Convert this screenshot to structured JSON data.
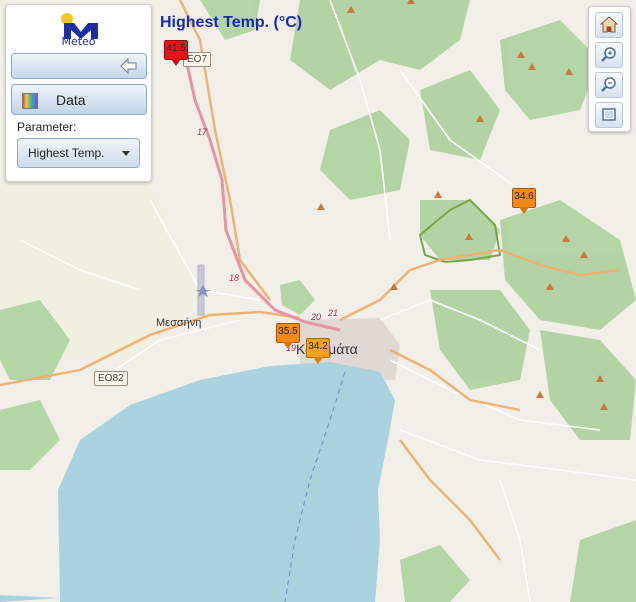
{
  "title": "Highest Temp. (°C)",
  "panel": {
    "logo_text": "Meteo",
    "data_label": "Data",
    "parameter_label": "Parameter:",
    "parameter_value": "Highest Temp."
  },
  "stations": [
    {
      "value": "41.5",
      "color": "#e8131c",
      "tip": "#c40f18"
    },
    {
      "value": "34.6",
      "color": "#f28a17",
      "tip": "#d8740c"
    },
    {
      "value": "35.5",
      "color": "#f28a17",
      "tip": "#d8740c"
    },
    {
      "value": "34.2",
      "color": "#f4a11c",
      "tip": "#d8850f"
    }
  ],
  "places": {
    "messini": "Μεσσήνη",
    "kalamata": "Καλαμάτα"
  },
  "roads": {
    "e82": "ΕΟ82",
    "e07": "ΕΟ7",
    "r17": "17",
    "r18": "18",
    "r19": "19",
    "r20": "20",
    "r21": "21"
  },
  "colors": {
    "sea": "#aad3df",
    "land": "#f2efe9",
    "forest": "#add19e",
    "motorway": "#e892a2",
    "primary": "#fcd6a4"
  }
}
